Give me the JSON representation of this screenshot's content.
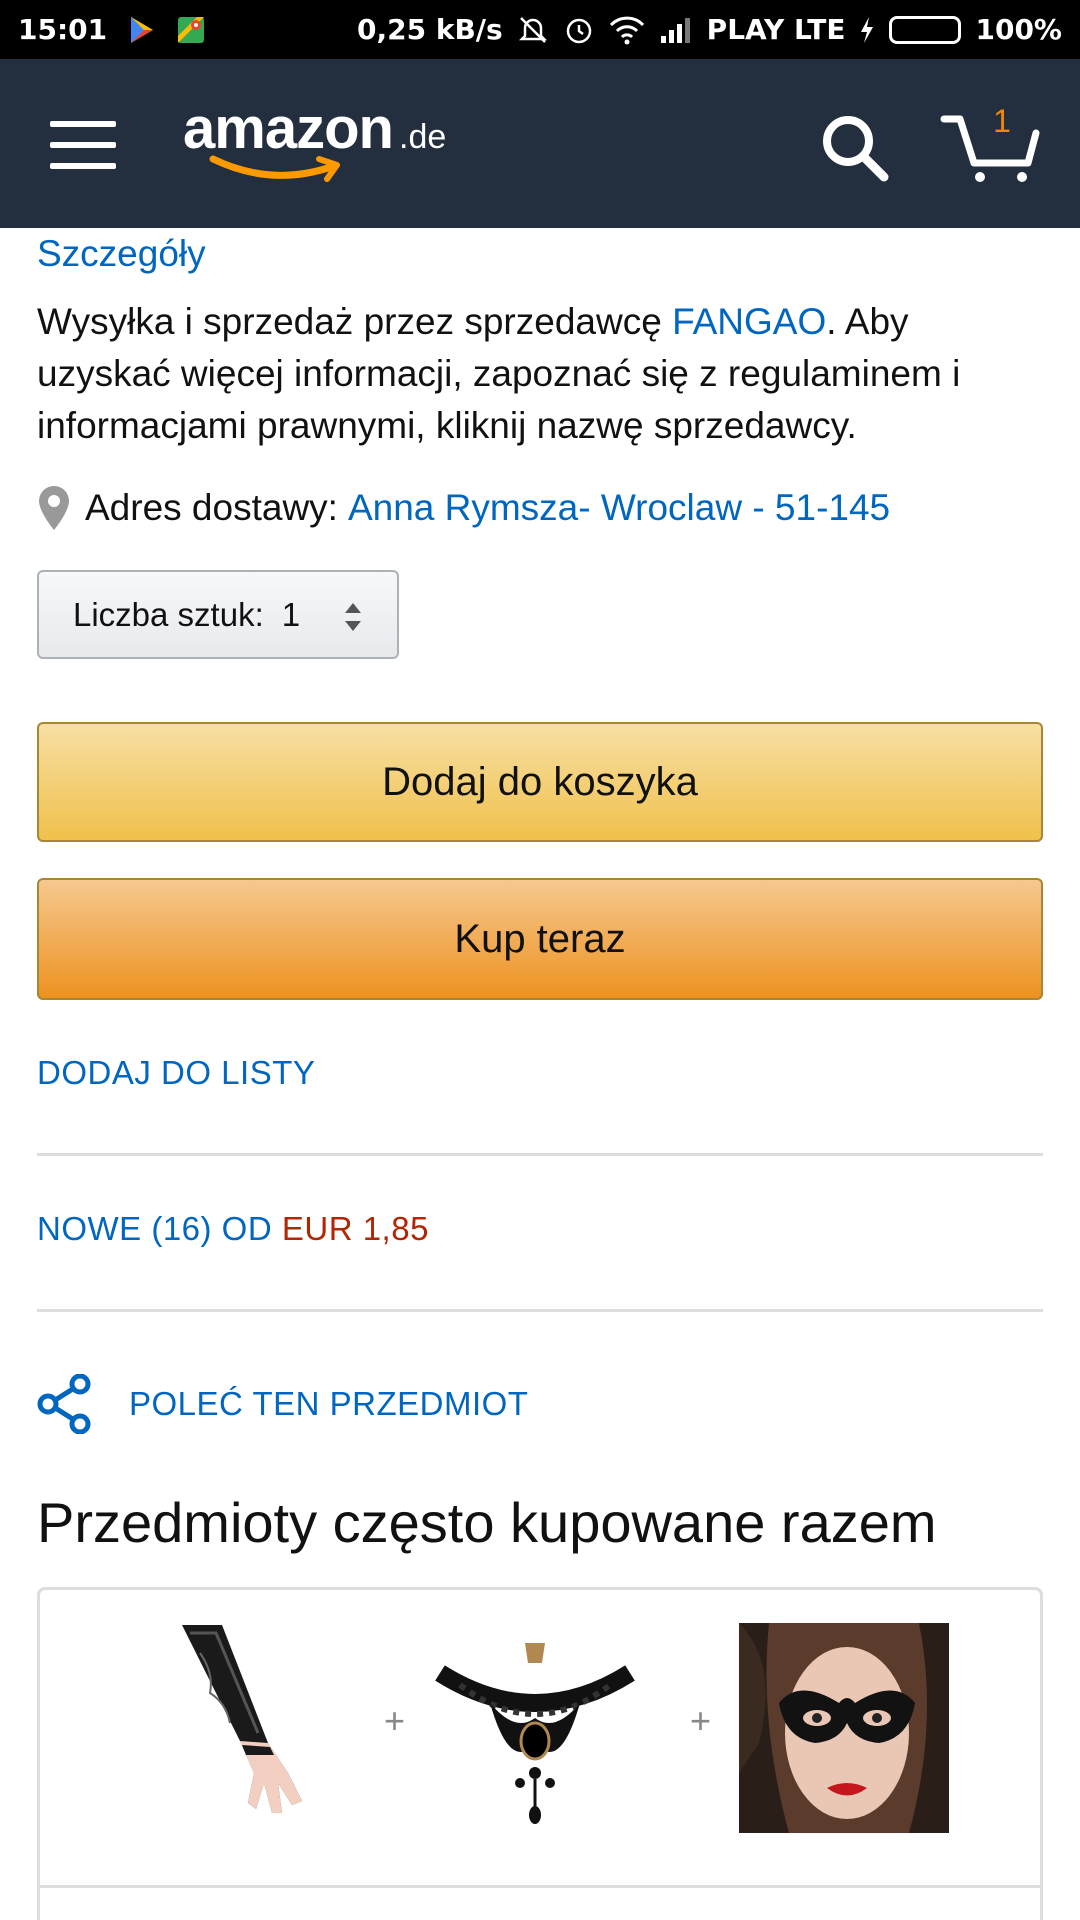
{
  "status_bar": {
    "time": "15:01",
    "network_speed": "0,25 kB/s",
    "carrier": "PLAY LTE",
    "battery": "100%",
    "icons": [
      "play-store-icon",
      "maps-icon",
      "mute-icon",
      "alarm-icon",
      "wifi-icon",
      "signal-icon",
      "charging-icon",
      "battery-icon"
    ]
  },
  "header": {
    "logo_text": "amazon",
    "logo_tld": ".de",
    "cart_count": "1",
    "colors": {
      "background": "#232f3e",
      "cart_count": "#f08804"
    }
  },
  "details": {
    "link": "Szczegóły",
    "seller_prefix": "Wysyłka i sprzedaż przez sprzedawcę ",
    "seller_name": "FANGAO",
    "seller_suffix": ". Aby uzyskać więcej informacji, zapoznać się z regulaminem i informacjami prawnymi, kliknij nazwę sprzedawcy."
  },
  "address": {
    "label": "Adres dostawy:",
    "value": "Anna Rymsza- Wroclaw - 51-145"
  },
  "quantity": {
    "label": "Liczba sztuk:",
    "value": "1"
  },
  "buttons": {
    "add_to_cart": "Dodaj do koszyka",
    "buy_now": "Kup teraz",
    "add_to_list": "DODAJ DO LISTY"
  },
  "offers": {
    "prefix": "NOWE (16) OD ",
    "price": "EUR 1,85"
  },
  "recommend": {
    "label": "POLEĆ TEN PRZEDMIOT"
  },
  "frequently_bought": {
    "title": "Przedmioty często kupowane razem",
    "plus": "+",
    "items": [
      "lace-glove-image",
      "lace-choker-necklace-image",
      "lace-mask-image"
    ]
  },
  "colors": {
    "link_blue": "#0066c0",
    "price_red": "#b12704",
    "add_to_cart_yellow": "#f0c14b",
    "buy_now_orange": "#ed9220"
  }
}
